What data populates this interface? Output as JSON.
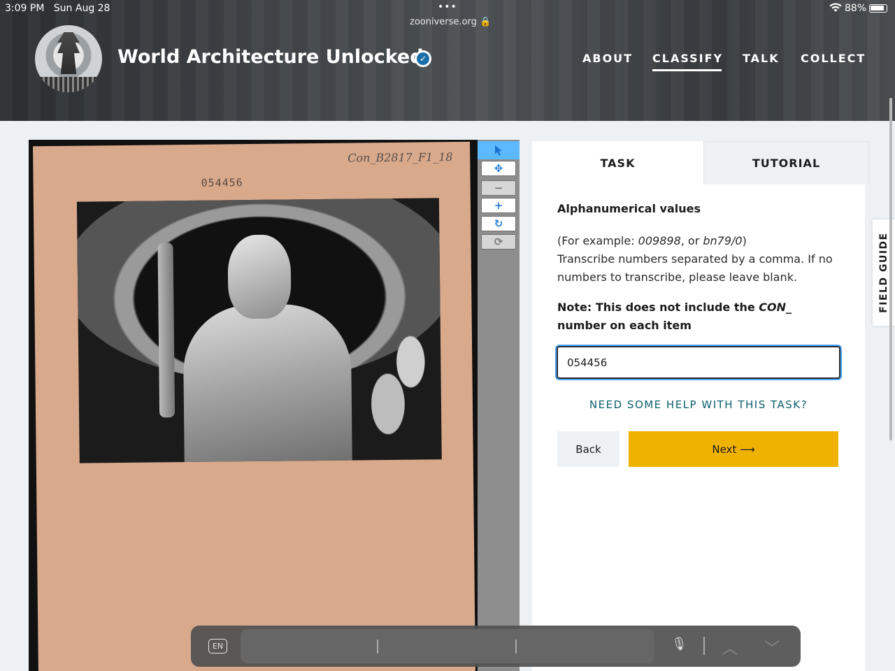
{
  "status_bar": {
    "time": "3:09 PM",
    "date": "Sun Aug 28",
    "url": "zooniverse.org",
    "battery": "88%",
    "dots": "•••"
  },
  "header": {
    "project_title": "World Architecture Unlocked",
    "nav": [
      {
        "label": "ABOUT"
      },
      {
        "label": "CLASSIFY"
      },
      {
        "label": "TALK"
      },
      {
        "label": "COLLECT"
      }
    ]
  },
  "subject": {
    "card_number": "054456",
    "card_code": "Con_B2817_F1_18"
  },
  "toolbar": {
    "tools": [
      "pointer-icon",
      "move-icon",
      "zoom-out-icon",
      "zoom-in-icon",
      "rotate-icon",
      "reset-icon"
    ]
  },
  "task_panel": {
    "tab_task": "TASK",
    "tab_tutorial": "TUTORIAL",
    "question_title": "Alphanumerical values",
    "example_prefix": "(For example: ",
    "example_1": "009898",
    "example_mid": ", or ",
    "example_2": "bn79/0",
    "example_suffix": ")",
    "instruction": "Transcribe numbers separated by a comma. If no numbers to transcribe, please leave blank.",
    "note_prefix": "Note: This does not include the ",
    "note_code": "CON_",
    "note_suffix": " number on each item",
    "answer_value": "054456",
    "help_link": "NEED SOME HELP WITH THIS TASK?",
    "back_label": "Back",
    "next_label": "Next",
    "next_arrow": "⟶"
  },
  "field_guide": {
    "label": "FIELD GUIDE"
  },
  "keyboard": {
    "lang": "EN",
    "mic": "🎙",
    "up": "︿",
    "down": "﹀"
  },
  "colors": {
    "next_button": "#f0b200",
    "help_link": "#0b5f6b",
    "active_tool": "#5cb8ff"
  }
}
